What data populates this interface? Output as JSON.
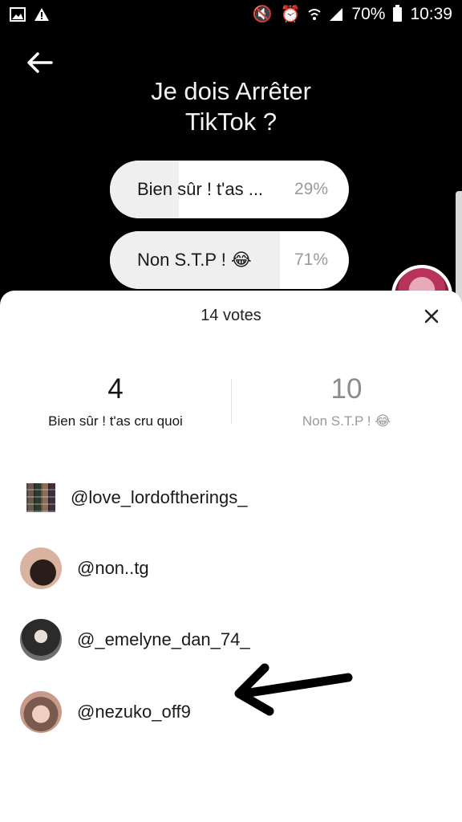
{
  "status_bar": {
    "battery_percent": "70%",
    "time": "10:39",
    "left_icons": [
      "image-icon",
      "warning-icon"
    ],
    "right_icons": [
      "mute-icon",
      "alarm-icon",
      "wifi-icon",
      "signal-icon",
      "battery-icon"
    ]
  },
  "poll": {
    "title": "Je dois Arrêter\nTikTok ?",
    "options": [
      {
        "label": "Bien sûr ! t'as ...",
        "percent_text": "29%",
        "percent": 29
      },
      {
        "label": "Non S.T.P ! 😂",
        "percent_text": "71%",
        "percent": 71
      }
    ]
  },
  "sheet": {
    "title": "14 votes",
    "tabs": [
      {
        "count": "4",
        "label": "Bien sûr ! t'as cru quoi"
      },
      {
        "count": "10",
        "label": "Non S.T.P ! 😂"
      }
    ],
    "voters": [
      {
        "username": "@love_lordoftherings_"
      },
      {
        "username": "@non..tg"
      },
      {
        "username": "@_emelyne_dan_74_"
      },
      {
        "username": "@nezuko_off9"
      }
    ]
  },
  "colors": {
    "background": "#000000",
    "sheet": "#ffffff",
    "option_fill": "#efefef"
  }
}
